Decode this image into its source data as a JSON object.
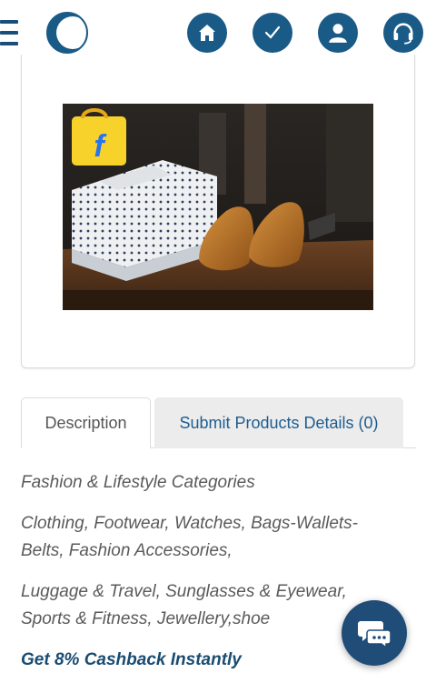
{
  "header": {
    "menu_icon": "hamburger-menu-icon",
    "logo_icon": "crescent-logo-icon",
    "nav_icons": [
      "home-icon",
      "check-icon",
      "user-icon",
      "headset-icon"
    ],
    "nav_color": "#1a5a86"
  },
  "product": {
    "image_icon": "product-photo-shirts-and-shoes"
  },
  "tabs": [
    {
      "label": "Description",
      "active": true
    },
    {
      "label": "Submit Products Details (0)",
      "active": false
    }
  ],
  "description": {
    "line1": "Fashion & Lifestyle Categories",
    "para2": "Clothing, Footwear, Watches, Bags-Wallets-Belts, Fashion Accessories,",
    "para3": "Luggage & Travel, Sunglasses & Eyewear, Sports & Fitness, Jewellery,shoe",
    "cashback": "Get 8% Cashback Instantly"
  },
  "chat": {
    "icon": "chat-bubbles-icon",
    "color": "#1f4d78"
  }
}
